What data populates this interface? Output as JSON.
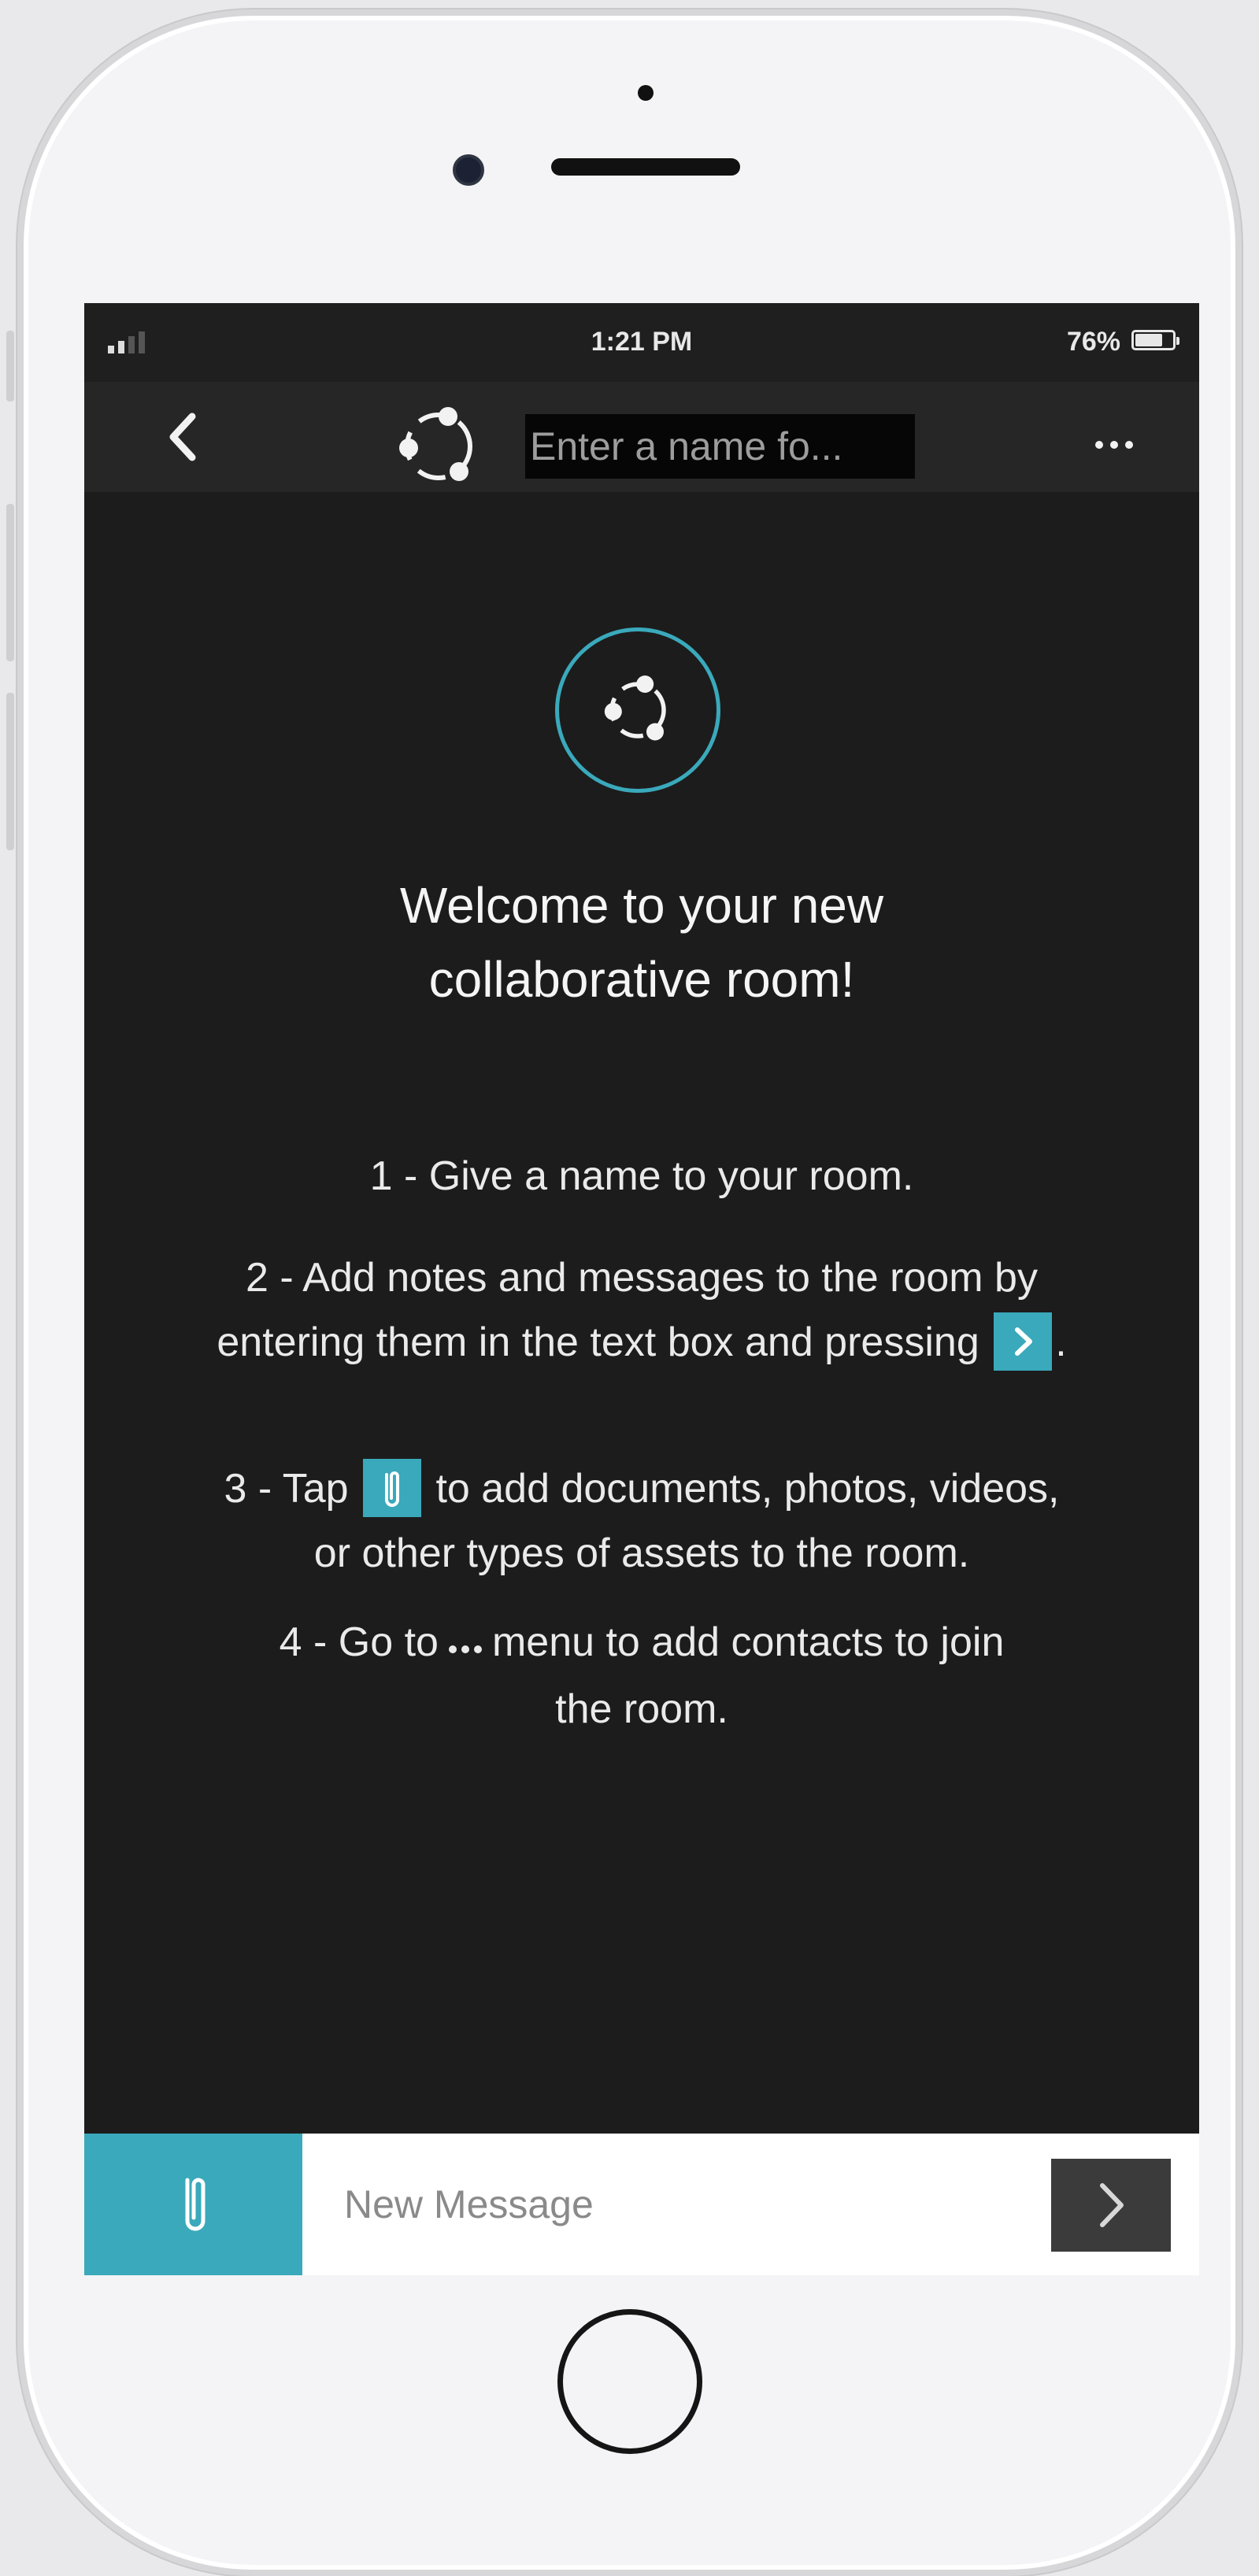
{
  "status_bar": {
    "time": "1:21 PM",
    "battery_percent": "76%",
    "battery_level": 0.76,
    "signal_icon": "cellular-signal-icon",
    "battery_icon": "battery-icon"
  },
  "nav_bar": {
    "back_icon": "chevron-left-icon",
    "room_icon": "collaboration-room-icon",
    "room_name_placeholder": "Enter a name fo...",
    "more_icon": "ellipsis-icon"
  },
  "welcome": {
    "title_line1": "Welcome to your new",
    "title_line2": "collaborative room!"
  },
  "steps": {
    "step1": "1 - Give a name to your room.",
    "step2_line1": "2 - Add notes and messages to the room by",
    "step2_line2_a": "entering them in the text box and pressing",
    "step2_line2_b": ".",
    "step3_line1_a": "3 - Tap",
    "step3_line1_b": "to add documents, photos, videos,",
    "step3_line2": "or other types of assets to the room.",
    "step4_line1_a": "4 - Go to",
    "step4_line1_b": "menu to add contacts to join",
    "step4_line2": "the room."
  },
  "composer": {
    "attach_icon": "paperclip-icon",
    "message_placeholder": "New Message",
    "send_icon": "chevron-right-icon"
  },
  "colors": {
    "accent": "#3aa9bb",
    "screen_background": "#1c1c1c",
    "nav_background": "#262626",
    "send_button": "#3b3b3b"
  }
}
